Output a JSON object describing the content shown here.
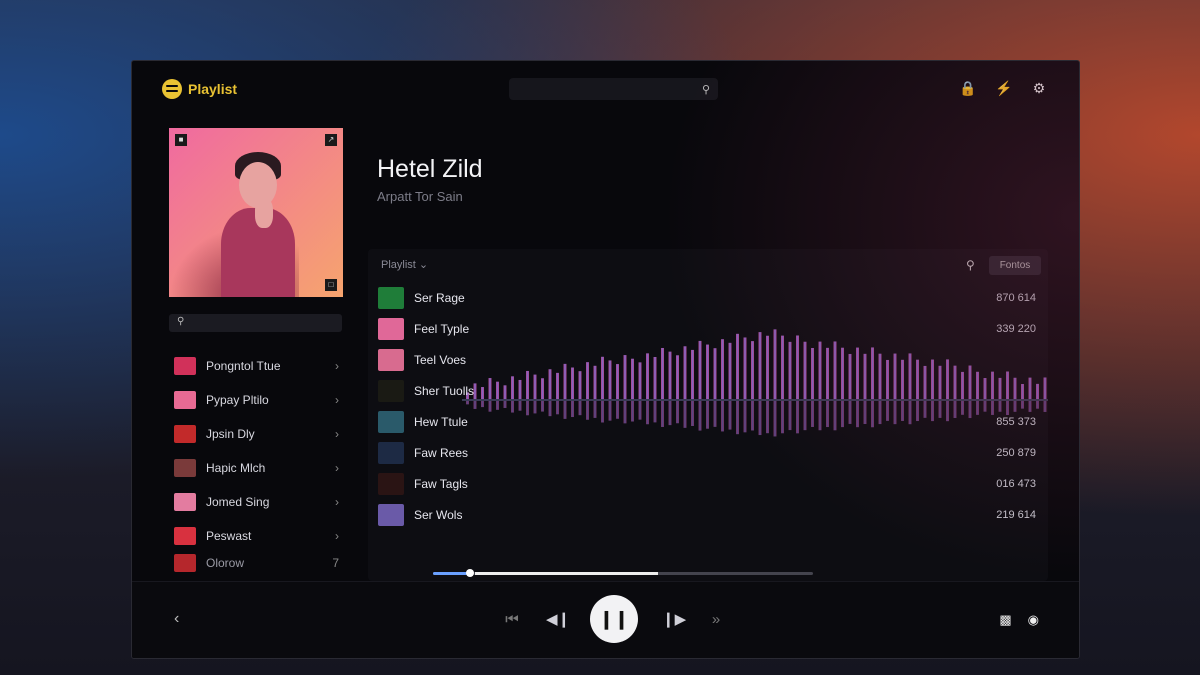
{
  "app": {
    "title": "Playlist",
    "logo_icon": "music-app-logo-icon"
  },
  "top_icons": [
    "lock-icon",
    "bolt-icon",
    "settings-icon"
  ],
  "album": {
    "title": "Hetel Zild",
    "subtitle": "Arpatt Tor Sain"
  },
  "sidebar": {
    "items": [
      {
        "label": "Pongntol Ttue",
        "thumb": "#d1315a"
      },
      {
        "label": "Pypay Pltilo",
        "thumb": "#e86a94"
      },
      {
        "label": "Jpsin Dly",
        "thumb": "#c22a2a"
      },
      {
        "label": "Hapic Mlch",
        "thumb": "#7a3a3a"
      },
      {
        "label": "Jomed Sing",
        "thumb": "#e37ca0"
      },
      {
        "label": "Peswast",
        "thumb": "#d8313f"
      },
      {
        "label": "Olorow",
        "thumb": "#b5272c"
      }
    ],
    "last_chevron": "7"
  },
  "panel": {
    "heading": "Playlist",
    "button": "Fontos",
    "tracks": [
      {
        "name": "Ser Rage",
        "duration": "870 614",
        "thumb": "#1f7d39"
      },
      {
        "name": "Feel Typle",
        "duration": "339 220",
        "thumb": "#e06898"
      },
      {
        "name": "Teel Voes",
        "duration": "",
        "thumb": "#d86b8f"
      },
      {
        "name": "Sher Tuolls",
        "duration": "",
        "thumb": "#1a1a14"
      },
      {
        "name": "Hew Ttule",
        "duration": "855 373",
        "thumb": "#2a5a6a"
      },
      {
        "name": "Faw Rees",
        "duration": "250 879",
        "thumb": "#1d2a44"
      },
      {
        "name": "Faw Tagls",
        "duration": "016 473",
        "thumb": "#2a1414"
      },
      {
        "name": "Ser Wols",
        "duration": "219 614",
        "thumb": "#6a5aa8"
      }
    ]
  },
  "player": {
    "progress": 0.09,
    "buffered": 0.57
  },
  "colors": {
    "accent": "#e9c233",
    "wave_center": "#8f7cf0",
    "wave_edge": "#d04a98"
  }
}
